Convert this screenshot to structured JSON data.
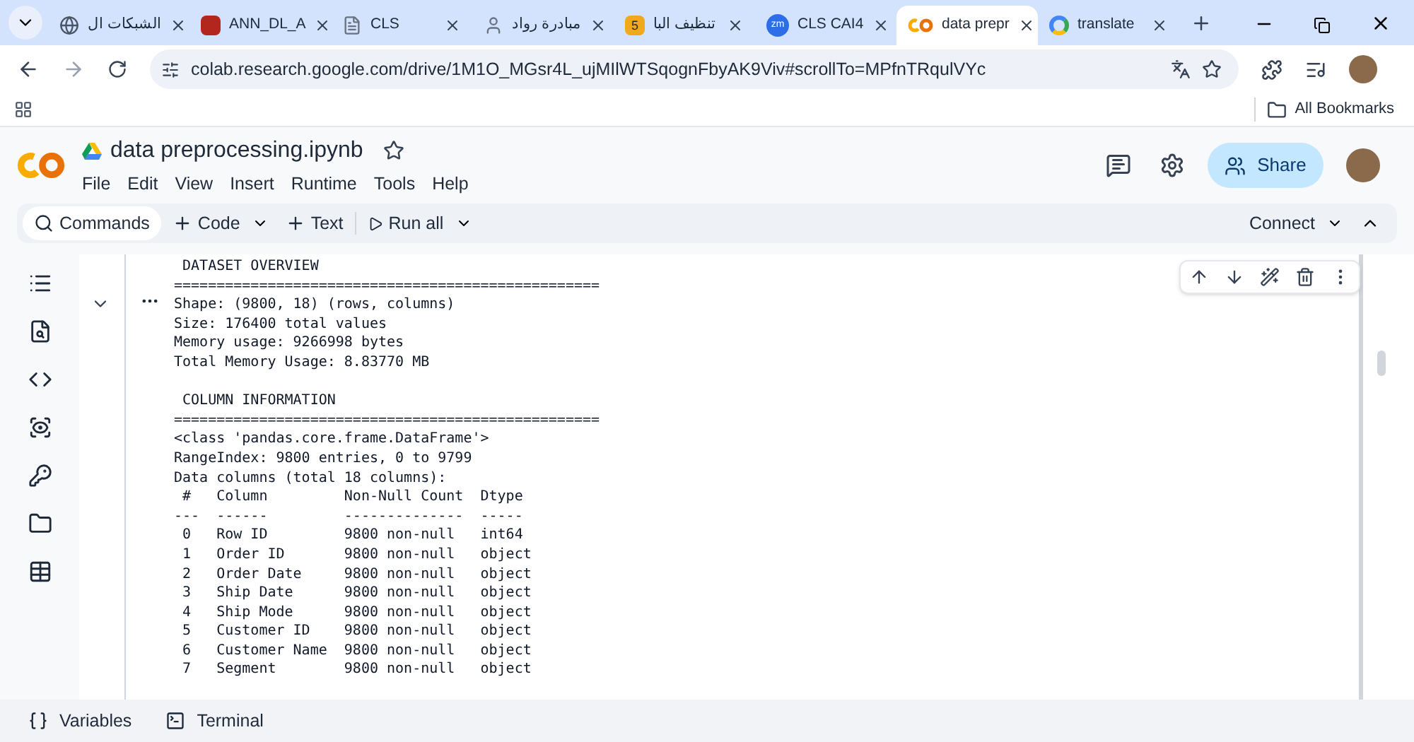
{
  "browser": {
    "tabs": [
      {
        "title": "الشبكات ال",
        "kind": "globe",
        "selected": false
      },
      {
        "title": "ANN_DL_A",
        "kind": "pdf",
        "selected": false
      },
      {
        "title": "CLS",
        "kind": "doc",
        "selected": false
      },
      {
        "title": "مبادرة رواد",
        "kind": "person",
        "selected": false
      },
      {
        "title": "تنظيف البا",
        "kind": "badge",
        "icon_text": "5",
        "selected": false
      },
      {
        "title": "CLS CAI4",
        "kind": "round",
        "icon_text": "zm",
        "selected": false
      },
      {
        "title": "data prepr",
        "kind": "colab",
        "selected": true
      },
      {
        "title": "translate",
        "kind": "google",
        "selected": false
      }
    ],
    "url": "colab.research.google.com/drive/1M1O_MGsr4L_ujMIlWTSqognFbyAK9Viv#scrollTo=MPfnTRqulVYc",
    "bookmarks_label": "All Bookmarks"
  },
  "notebook": {
    "title": "data preprocessing.ipynb",
    "menu": [
      "File",
      "Edit",
      "View",
      "Insert",
      "Runtime",
      "Tools",
      "Help"
    ],
    "share": "Share"
  },
  "toolbar": {
    "commands": "Commands",
    "code": "Code",
    "text": "Text",
    "run_all": "Run all",
    "connect": "Connect"
  },
  "output": {
    "sections": [
      [
        " DATASET OVERVIEW",
        "==================================================",
        "Shape: (9800, 18) (rows, columns)",
        "Size: 176400 total values",
        "Memory usage: 9266998 bytes",
        "Total Memory Usage: 8.83770 MB"
      ],
      [
        " COLUMN INFORMATION",
        "==================================================",
        "<class 'pandas.core.frame.DataFrame'>",
        "RangeIndex: 9800 entries, 0 to 9799",
        "Data columns (total 18 columns):",
        " #   Column         Non-Null Count  Dtype",
        "---  ------         --------------  -----",
        " 0   Row ID         9800 non-null   int64",
        " 1   Order ID       9800 non-null   object",
        " 2   Order Date     9800 non-null   object",
        " 3   Ship Date      9800 non-null   object",
        " 4   Ship Mode      9800 non-null   object",
        " 5   Customer ID    9800 non-null   object",
        " 6   Customer Name  9800 non-null   object",
        " 7   Segment        9800 non-null   object"
      ]
    ]
  },
  "bottom_bar": {
    "variables": "Variables",
    "terminal": "Terminal"
  }
}
